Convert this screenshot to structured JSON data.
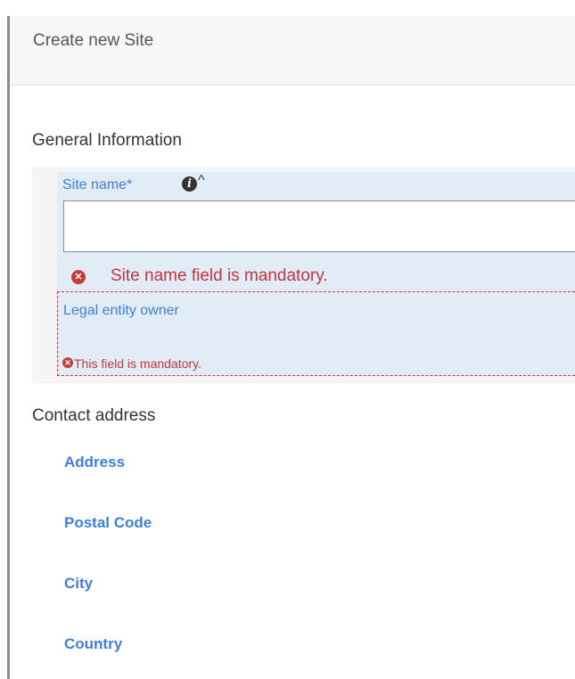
{
  "header": {
    "title": "Create new Site"
  },
  "general": {
    "heading": "General Information",
    "site_name": {
      "label": "Site name*",
      "value": "",
      "error": "Site name field is mandatory."
    },
    "legal_entity": {
      "label": "Legal entity owner",
      "error": "This field is mandatory."
    }
  },
  "contact": {
    "heading": "Contact address",
    "items": [
      "Address",
      "Postal Code",
      "City",
      "Country"
    ]
  },
  "icons": {
    "info": "info-icon",
    "caret": "caret-up-icon",
    "error": "error-circle-icon"
  },
  "colors": {
    "field_label": "#3e7fd9",
    "error": "#c0373f",
    "field_bg": "#e2ecf7"
  }
}
